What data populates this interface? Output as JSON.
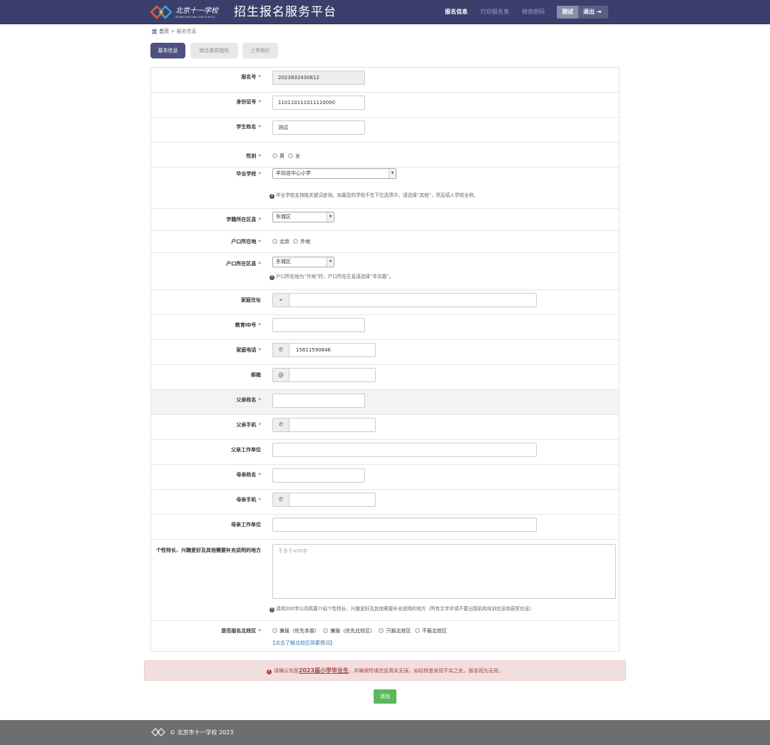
{
  "header": {
    "title": "招生报名服务平台",
    "nav": [
      "报名信息",
      "打印报名表",
      "修改密码"
    ],
    "user": "测试",
    "logout": "退出"
  },
  "breadcrumb": {
    "home": "首页",
    "current": "报名信息"
  },
  "tabs": [
    "基本信息",
    "综合素质指标",
    "上传照片"
  ],
  "form": {
    "reg_no": {
      "label": "报名号",
      "value": "2023832430812"
    },
    "id_no": {
      "label": "身份证号",
      "value": "110110111011110000"
    },
    "student_name": {
      "label": "学生姓名",
      "value": "测试"
    },
    "gender": {
      "label": "性别",
      "options": [
        "男",
        "女"
      ]
    },
    "school": {
      "label": "毕业学校",
      "value": "羊坊店中心小学",
      "hint": "毕业学校支持按关键词查询。如果您的学校不在下拉选项中，请选择“其他”，然后填入学校全称。"
    },
    "district": {
      "label": "学籍所在区县",
      "value": "东城区"
    },
    "hukou": {
      "label": "户口所在地",
      "options": [
        "北京",
        "外地"
      ]
    },
    "hukou_district": {
      "label": "户口所在区县",
      "value": "东城区",
      "hint": "户口所在地为“外地”时，户口所在区县请选择“非京籍”。"
    },
    "address": {
      "label": "家庭住址",
      "value": ""
    },
    "edu_id": {
      "label": "教育ID号",
      "value": ""
    },
    "phone": {
      "label": "家庭电话",
      "value": "15811590646"
    },
    "email": {
      "label": "邮箱",
      "value": "",
      "addon": "@"
    },
    "father_name": {
      "label": "父亲姓名",
      "value": ""
    },
    "father_phone": {
      "label": "父亲手机",
      "value": ""
    },
    "father_work": {
      "label": "父亲工作单位",
      "value": ""
    },
    "mother_name": {
      "label": "母亲姓名",
      "value": ""
    },
    "mother_phone": {
      "label": "母亲手机",
      "value": ""
    },
    "mother_work": {
      "label": "母亲工作单位",
      "value": ""
    },
    "talent": {
      "label": "个性特长、兴趣爱好及其他需要补充说明的地方",
      "placeholder": "不多于400字",
      "hint": "请用300字以内简要介绍个性特长、兴趣爱好及其他需要补充说明的地方（所有文字中请不要出现机构培训信息和获奖信息）"
    },
    "north_campus": {
      "label": "是否报名北校区",
      "options": [
        "兼报（优先本部）",
        "兼报（优先北校区）",
        "只报北校区",
        "不报北校区"
      ],
      "link": "【点击了解北校区简要情况】"
    },
    "required_mark": "*"
  },
  "alert": {
    "prefix": "请确认你是",
    "emph": "2023届小学毕业生",
    "suffix": "，并确保所填信息真实无误，如经核查发现不实之处，报名视为无效。"
  },
  "submit": "添加",
  "footer": {
    "text": "© 北京市十一学校 2023"
  },
  "colors": {
    "header": "#3b3f6b",
    "accent": "#4d5280",
    "success": "#5cb85c",
    "danger": "#a94442"
  }
}
